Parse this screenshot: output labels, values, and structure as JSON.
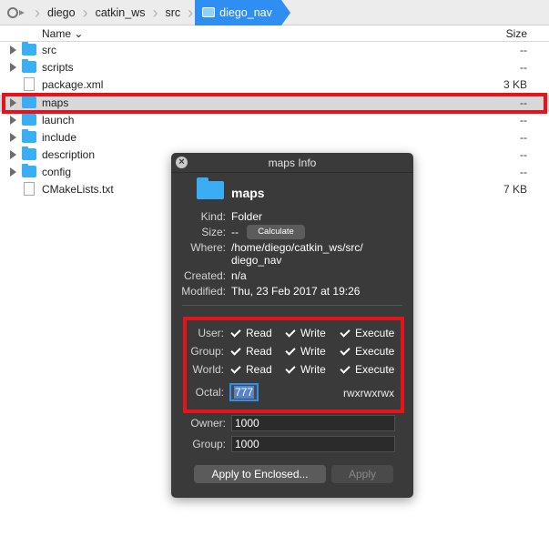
{
  "breadcrumb": {
    "items": [
      "diego",
      "catkin_ws",
      "src"
    ],
    "current": "diego_nav"
  },
  "columns": {
    "name": "Name",
    "size": "Size"
  },
  "files": [
    {
      "name": "src",
      "size": "--",
      "type": "folder"
    },
    {
      "name": "scripts",
      "size": "--",
      "type": "folder"
    },
    {
      "name": "package.xml",
      "size": "3 KB",
      "type": "file"
    },
    {
      "name": "maps",
      "size": "--",
      "type": "folder",
      "selected": true
    },
    {
      "name": "launch",
      "size": "--",
      "type": "folder"
    },
    {
      "name": "include",
      "size": "--",
      "type": "folder"
    },
    {
      "name": "description",
      "size": "--",
      "type": "folder"
    },
    {
      "name": "config",
      "size": "--",
      "type": "folder"
    },
    {
      "name": "CMakeLists.txt",
      "size": "7 KB",
      "type": "file"
    }
  ],
  "info": {
    "title": "maps Info",
    "name": "maps",
    "kind_label": "Kind:",
    "kind": "Folder",
    "size_label": "Size:",
    "size": "--",
    "calculate_label": "Calculate",
    "where_label": "Where:",
    "where_line1": "/home/diego/catkin_ws/src/",
    "where_line2": "diego_nav",
    "created_label": "Created:",
    "created": "n/a",
    "modified_label": "Modified:",
    "modified": "Thu, 23 Feb 2017 at 19:26",
    "perm_rows": [
      "User:",
      "Group:",
      "World:"
    ],
    "perm_cols": [
      "Read",
      "Write",
      "Execute"
    ],
    "octal_label": "Octal:",
    "octal": "777",
    "octal_string": "rwxrwxrwx",
    "owner_label": "Owner:",
    "owner": "1000",
    "group_label": "Group:",
    "group": "1000",
    "apply_enclosed_label": "Apply to Enclosed...",
    "apply_label": "Apply"
  },
  "colors": {
    "accent": "#2f8ef2",
    "highlight": "#e8121a",
    "folder": "#3aaef5",
    "panel": "#3a3a3a"
  }
}
